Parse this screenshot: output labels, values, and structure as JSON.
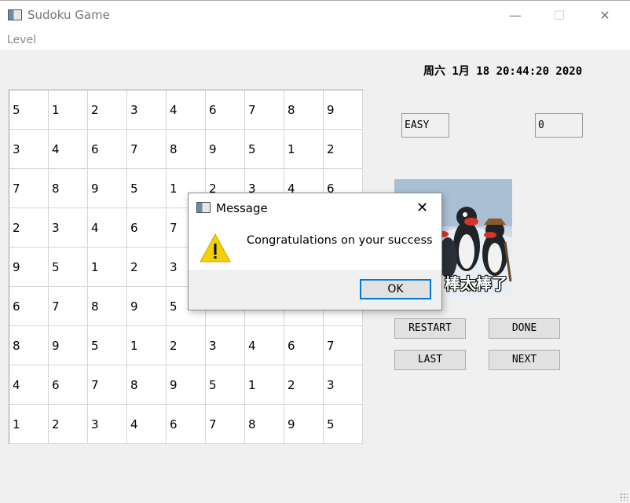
{
  "window": {
    "title": "Sudoku Game",
    "minimize": "—",
    "maximize": "☐",
    "close": "✕"
  },
  "menu": {
    "level": "Level"
  },
  "datetime": "周六 1月 18 20:44:20 2020",
  "grid": [
    [
      5,
      1,
      2,
      3,
      4,
      6,
      7,
      8,
      9
    ],
    [
      3,
      4,
      6,
      7,
      8,
      9,
      5,
      1,
      2
    ],
    [
      7,
      8,
      9,
      5,
      1,
      2,
      3,
      4,
      6
    ],
    [
      2,
      3,
      4,
      6,
      7,
      "",
      "",
      "",
      ""
    ],
    [
      9,
      5,
      1,
      2,
      3,
      "",
      "",
      "",
      ""
    ],
    [
      6,
      7,
      8,
      9,
      5,
      "",
      "",
      "",
      ""
    ],
    [
      8,
      9,
      5,
      1,
      2,
      3,
      4,
      6,
      7
    ],
    [
      4,
      6,
      7,
      8,
      9,
      5,
      1,
      2,
      3
    ],
    [
      1,
      2,
      3,
      4,
      6,
      7,
      8,
      9,
      5
    ]
  ],
  "fields": {
    "level": "EASY",
    "score": "0"
  },
  "picture": {
    "caption": "棒太棒了"
  },
  "buttons": {
    "restart": "RESTART",
    "done": "DONE",
    "last": "LAST",
    "next": "NEXT"
  },
  "dialog": {
    "title": "Message",
    "close": "✕",
    "message": "Congratulations on your success",
    "ok": "OK",
    "icon": "warning-icon"
  }
}
